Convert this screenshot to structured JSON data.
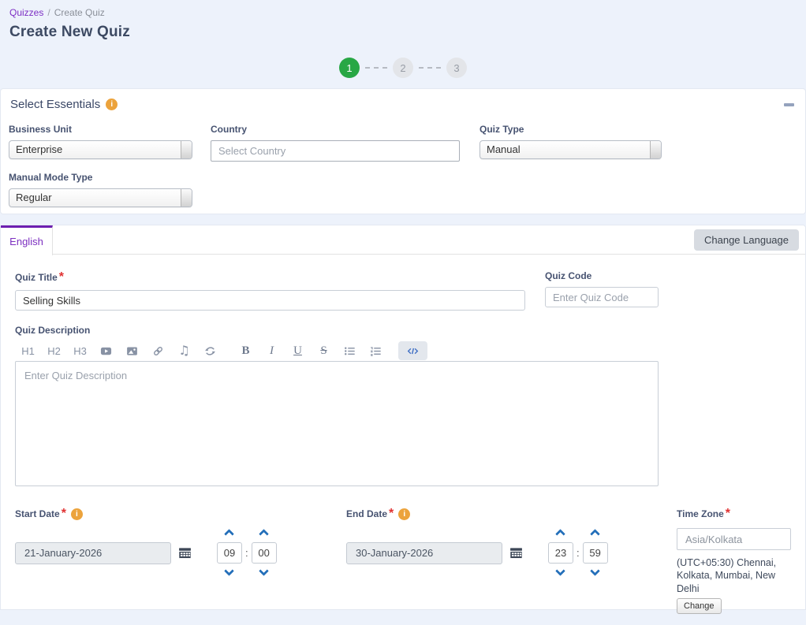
{
  "breadcrumb": {
    "link": "Quizzes",
    "separator": "/",
    "current": "Create Quiz"
  },
  "page_title": "Create New Quiz",
  "stepper": {
    "steps": [
      {
        "label": "1",
        "state": "active"
      },
      {
        "label": "2",
        "state": "inactive"
      },
      {
        "label": "3",
        "state": "inactive"
      }
    ]
  },
  "essentials": {
    "title": "Select Essentials",
    "business_unit": {
      "label": "Business Unit",
      "value": "Enterprise"
    },
    "country": {
      "label": "Country",
      "placeholder": "Select Country"
    },
    "quiz_type": {
      "label": "Quiz Type",
      "value": "Manual"
    },
    "manual_mode_type": {
      "label": "Manual Mode Type",
      "value": "Regular"
    }
  },
  "language_panel": {
    "active_tab": "English",
    "change_language_button": "Change Language",
    "quiz_title": {
      "label": "Quiz Title",
      "required_marker": "*",
      "value": "Selling Skills"
    },
    "quiz_code": {
      "label": "Quiz Code",
      "placeholder": "Enter Quiz Code"
    },
    "quiz_description": {
      "label": "Quiz Description",
      "placeholder": "Enter Quiz Description",
      "toolbar": [
        {
          "name": "h1",
          "label": "H1"
        },
        {
          "name": "h2",
          "label": "H2"
        },
        {
          "name": "h3",
          "label": "H3"
        },
        {
          "name": "video",
          "label": ""
        },
        {
          "name": "image",
          "label": ""
        },
        {
          "name": "link",
          "label": ""
        },
        {
          "name": "music",
          "label": ""
        },
        {
          "name": "refresh",
          "label": ""
        },
        {
          "name": "bold",
          "label": "B"
        },
        {
          "name": "italic",
          "label": "I"
        },
        {
          "name": "underline",
          "label": "U"
        },
        {
          "name": "strikethrough",
          "label": "S"
        },
        {
          "name": "unordered-list",
          "label": ""
        },
        {
          "name": "ordered-list",
          "label": ""
        },
        {
          "name": "code",
          "label": ""
        }
      ]
    }
  },
  "schedule": {
    "start_date": {
      "label": "Start Date",
      "required_marker": "*",
      "value": "21-January-2026",
      "hour": "09",
      "minute": "00"
    },
    "end_date": {
      "label": "End Date",
      "required_marker": "*",
      "value": "30-January-2026",
      "hour": "23",
      "minute": "59"
    },
    "time_zone": {
      "label": "Time Zone",
      "required_marker": "*",
      "value": "Asia/Kolkata",
      "description": "(UTC+05:30) Chennai, Kolkata, Mumbai, New Delhi",
      "change_button": "Change"
    }
  },
  "colors": {
    "accent_purple": "#7c2fc0",
    "active_step_green": "#28a745",
    "info_orange": "#eca33c",
    "spinner_blue": "#2570ba",
    "page_background": "#edf2fb"
  }
}
